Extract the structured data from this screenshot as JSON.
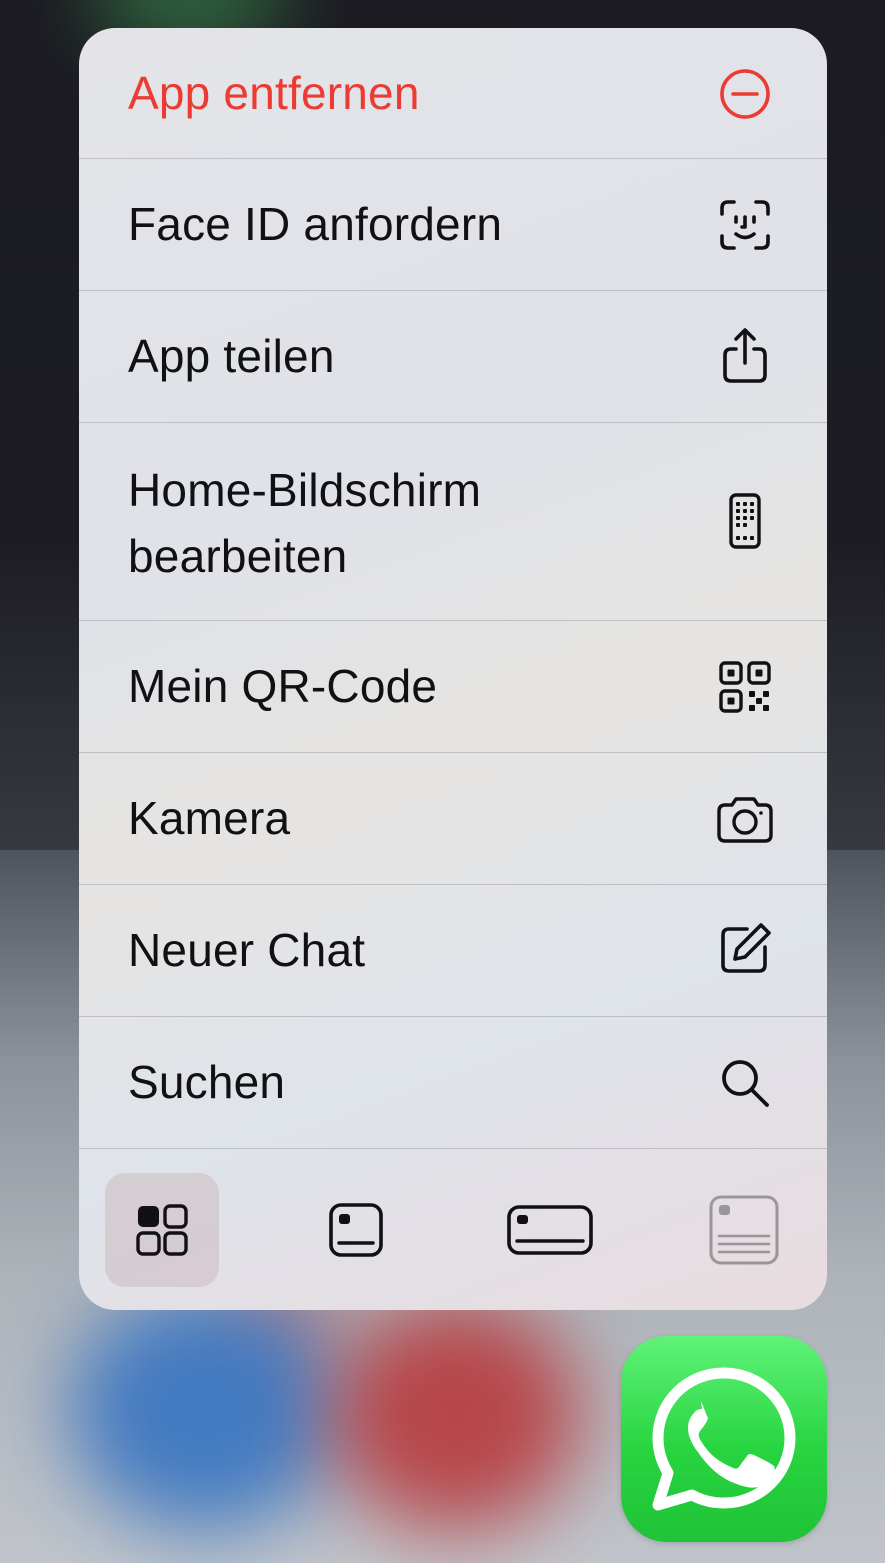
{
  "menu": {
    "items": [
      {
        "label": "App entfernen",
        "icon": "remove-circle-icon",
        "destructive": true
      },
      {
        "label": "Face ID anfordern",
        "icon": "face-id-icon"
      },
      {
        "label": "App teilen",
        "icon": "share-icon"
      },
      {
        "label_line1": "Home-Bildschirm",
        "label_line2": "bearbeiten",
        "icon": "phone-apps-icon"
      },
      {
        "label": "Mein QR-Code",
        "icon": "qr-code-icon"
      },
      {
        "label": "Kamera",
        "icon": "camera-icon"
      },
      {
        "label": "Neuer Chat",
        "icon": "compose-icon"
      },
      {
        "label": "Suchen",
        "icon": "search-icon"
      }
    ],
    "widget_sizes": [
      {
        "icon": "small-widget-grid-icon",
        "selected": true
      },
      {
        "icon": "small-widget-icon",
        "selected": false
      },
      {
        "icon": "medium-widget-icon",
        "selected": false
      },
      {
        "icon": "large-widget-icon",
        "selected": false,
        "disabled": true
      }
    ]
  },
  "app": {
    "icon": "whatsapp-icon"
  },
  "colors": {
    "destructive": "#eb3b32",
    "text": "#111113",
    "whatsapp_green": "#28d440"
  }
}
